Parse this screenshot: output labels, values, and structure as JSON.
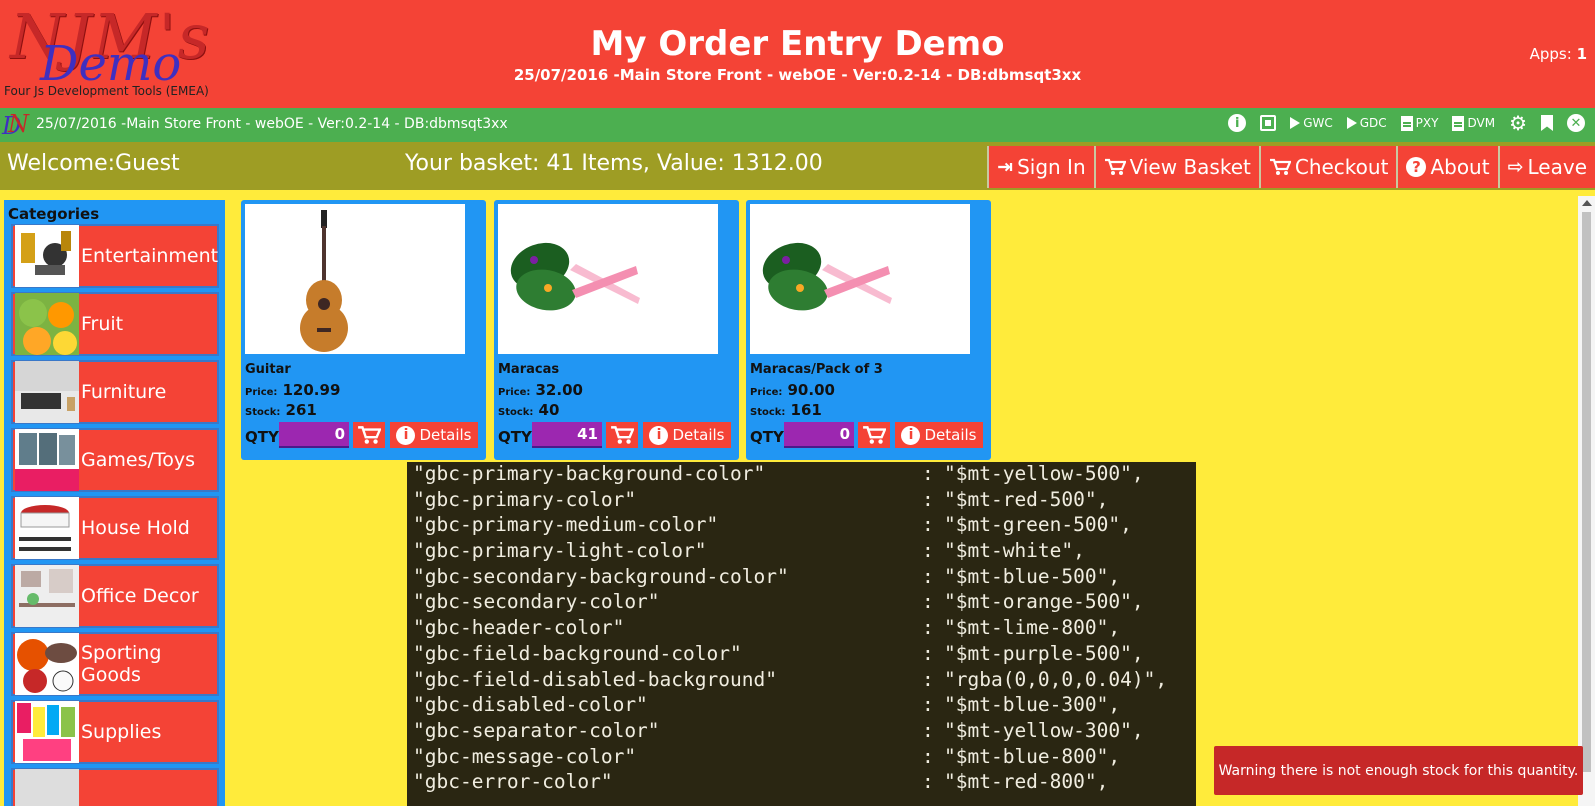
{
  "header": {
    "logo_text": "NJM's",
    "logo_demo": "Demo",
    "logo_subtitle": "Four Js Development Tools (EMEA)",
    "title": "My Order Entry Demo",
    "subtitle": "25/07/2016 -Main Store Front - webOE - Ver:0.2-14 - DB:dbmsqt3xx",
    "apps_label": "Apps:",
    "apps_count": "1"
  },
  "toolbar": {
    "info_text": "25/07/2016 -Main Store Front - webOE - Ver:0.2-14 - DB:dbmsqt3xx",
    "gwc": "GWC",
    "gdc": "GDC",
    "pxy": "PXY",
    "dvm": "DVM"
  },
  "nav": {
    "welcome": "Welcome:Guest",
    "basket": "Your basket: 41 Items, Value: 1312.00",
    "sign_in": "Sign In",
    "view_basket": "View Basket",
    "checkout": "Checkout",
    "about": "About",
    "leave": "Leave"
  },
  "sidebar": {
    "title": "Categories",
    "items": [
      {
        "label": "Entertainment"
      },
      {
        "label": "Fruit"
      },
      {
        "label": "Furniture"
      },
      {
        "label": "Games/Toys"
      },
      {
        "label": "House Hold"
      },
      {
        "label": "Office Decor"
      },
      {
        "label": "Sporting Goods"
      },
      {
        "label": "Supplies"
      }
    ]
  },
  "products": [
    {
      "name": "Guitar",
      "price_label": "Price:",
      "price": "120.99",
      "stock_label": "Stock:",
      "stock": "261",
      "qty_label": "QTY:",
      "qty": "0",
      "details": "Details"
    },
    {
      "name": "Maracas",
      "price_label": "Price:",
      "price": "32.00",
      "stock_label": "Stock:",
      "stock": "40",
      "qty_label": "QTY:",
      "qty": "41",
      "details": "Details"
    },
    {
      "name": "Maracas/Pack of 3",
      "price_label": "Price:",
      "price": "90.00",
      "stock_label": "Stock:",
      "stock": "161",
      "qty_label": "QTY:",
      "qty": "0",
      "details": "Details"
    }
  ],
  "code_lines": [
    {
      "key": "\"gbc-primary-background-color\"",
      "value": "\"$mt-yellow-500\","
    },
    {
      "key": "\"gbc-primary-color\"",
      "value": "\"$mt-red-500\","
    },
    {
      "key": "\"gbc-primary-medium-color\"",
      "value": "\"$mt-green-500\","
    },
    {
      "key": "\"gbc-primary-light-color\"",
      "value": "\"$mt-white\","
    },
    {
      "key": "\"gbc-secondary-background-color\"",
      "value": "\"$mt-blue-500\","
    },
    {
      "key": "\"gbc-secondary-color\"",
      "value": "\"$mt-orange-500\","
    },
    {
      "key": "\"gbc-header-color\"",
      "value": "\"$mt-lime-800\","
    },
    {
      "key": "\"gbc-field-background-color\"",
      "value": "\"$mt-purple-500\","
    },
    {
      "key": "\"gbc-field-disabled-background\"",
      "value": "\"rgba(0,0,0,0.04)\","
    },
    {
      "key": "\"gbc-disabled-color\"",
      "value": "\"$mt-blue-300\","
    },
    {
      "key": "\"gbc-separator-color\"",
      "value": "\"$mt-yellow-300\","
    },
    {
      "key": "\"gbc-message-color\"",
      "value": "\"$mt-blue-800\","
    },
    {
      "key": "\"gbc-error-color\"",
      "value": "\"$mt-red-800\","
    }
  ],
  "code_colon": ":",
  "toast": "Warning there is not enough stock for this quantity.",
  "colors": {
    "primary_bg": "#ffeb3b",
    "primary": "#f44336",
    "medium": "#4caf50",
    "secondary_bg": "#2196f3",
    "header": "#9e9d24",
    "field_bg": "#9c27b0",
    "error": "#c62828"
  },
  "icons": [
    "info-icon",
    "chip-icon",
    "play-icon",
    "file-icon",
    "gear-icon",
    "bookmark-icon",
    "close-icon",
    "sign-in-icon",
    "cart-icon",
    "question-icon",
    "leave-icon"
  ]
}
